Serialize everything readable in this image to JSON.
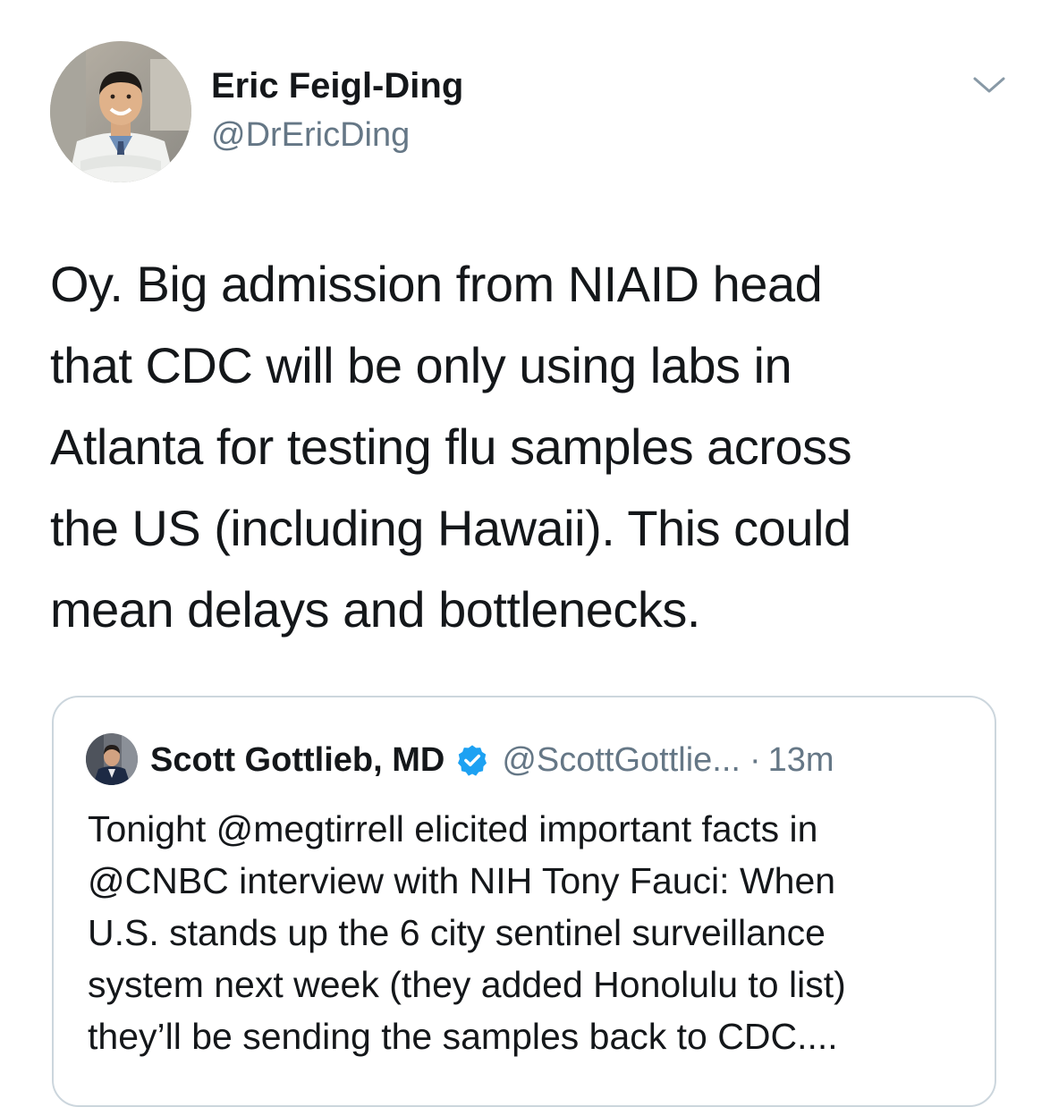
{
  "tweet": {
    "author": {
      "name": "Eric Feigl-Ding",
      "handle": "@DrEricDing",
      "avatar_icon": "profile-photo"
    },
    "menu_icon": "chevron-down-icon",
    "text_lines": [
      "Oy. Big admission from NIAID head",
      "that CDC will be only using labs in",
      "Atlanta for testing flu samples across",
      "the US (including Hawaii). This could",
      "mean delays and bottlenecks."
    ]
  },
  "quote": {
    "author": {
      "name": "Scott Gottlieb, MD",
      "handle": "@ScottGottlie...",
      "verified": true
    },
    "separator": "·",
    "time": "13m",
    "text_lines": [
      "Tonight @megtirrell elicited important facts in",
      "@CNBC interview with NIH Tony Fauci: When",
      "U.S. stands up the 6 city sentinel surveillance",
      "system next week (they added Honolulu to list)",
      "they’ll be sending the samples back to CDC...."
    ]
  },
  "colors": {
    "text_primary": "#14171a",
    "text_secondary": "#657786",
    "border": "#ccd6dd",
    "verified_blue": "#1da1f2"
  }
}
